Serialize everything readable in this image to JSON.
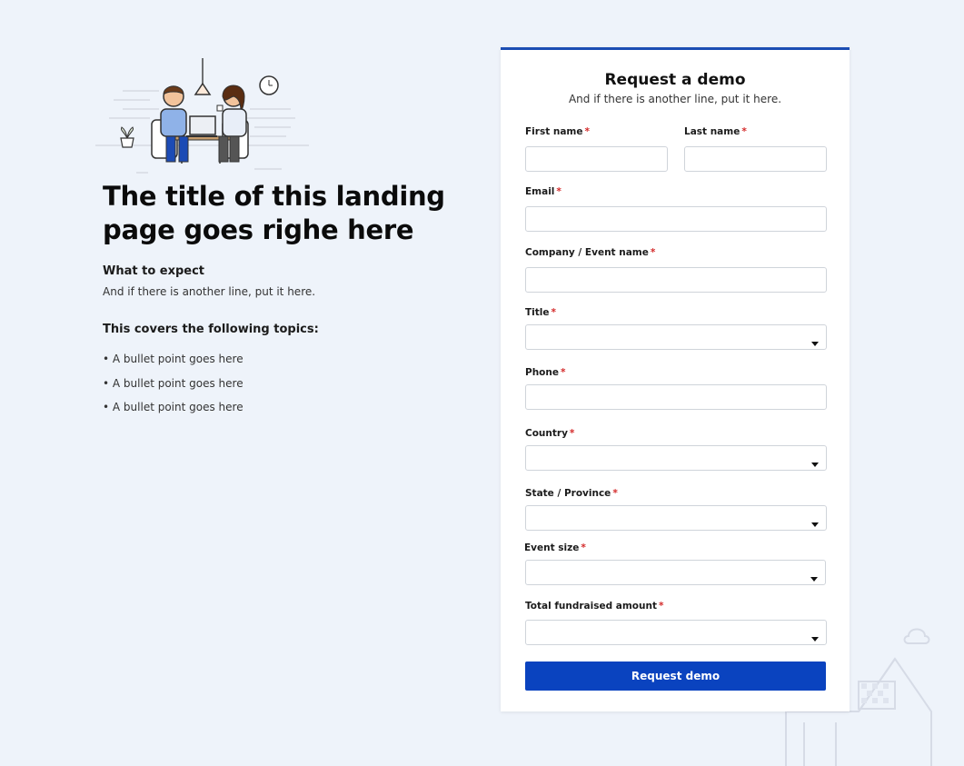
{
  "hero": {
    "title": "The title of this landing page goes righe here",
    "expect_heading": "What to expect",
    "expect_text": "And if there is another line, put it here.",
    "topics_heading": "This covers the following topics:",
    "bullets": [
      "A bullet point goes here",
      "A bullet point goes here",
      "A bullet point goes here"
    ]
  },
  "form": {
    "title": "Request a demo",
    "subtitle": "And if there is another line, put it here.",
    "required_mark": "*",
    "fields": {
      "first_name": "First name",
      "last_name": "Last name",
      "email": "Email",
      "company": "Company / Event name",
      "title": "Title",
      "phone": "Phone",
      "country": "Country",
      "state": "State / Province",
      "event_size": "Event size",
      "total_fundraised": "Total fundraised amount"
    },
    "submit_label": "Request demo"
  },
  "colors": {
    "page_bg": "#eef3fa",
    "accent": "#0a43bf",
    "required": "#d42a2a"
  },
  "icons": [
    "illustration-people-laptop",
    "caret-down-icon",
    "house-cloud-illustration"
  ]
}
